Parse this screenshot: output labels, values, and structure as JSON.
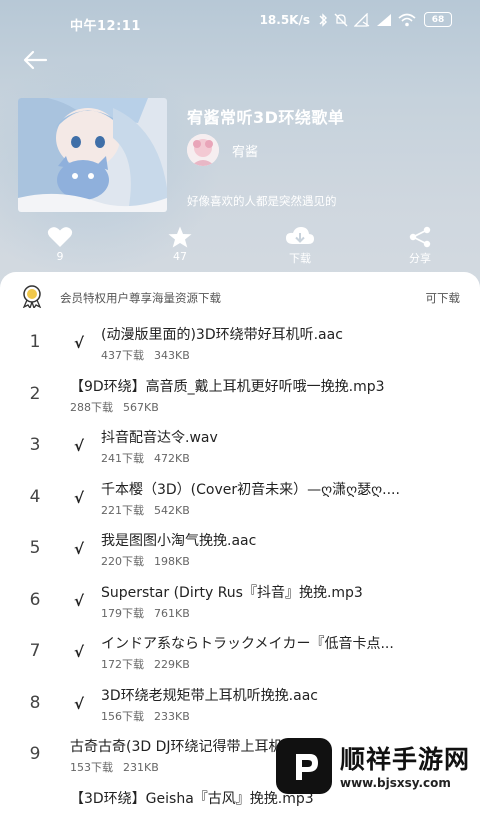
{
  "status_bar": {
    "time": "中午12:11",
    "network_speed": "18.5K/s",
    "battery": "68"
  },
  "header": {
    "title": "宥酱常听3D环绕歌单",
    "author": "宥酱",
    "description": "好像喜欢的人都是突然遇见的"
  },
  "actions": [
    {
      "icon": "heart-icon",
      "label": "9"
    },
    {
      "icon": "star-icon",
      "label": "47"
    },
    {
      "icon": "download-icon",
      "label": "下载"
    },
    {
      "icon": "share-icon",
      "label": "分享"
    }
  ],
  "vip_bar": {
    "text": "会员特权用户尊享海量资源下载",
    "link": "可下载"
  },
  "songs": [
    {
      "index": "1",
      "check": "√",
      "name": "(动漫版里面的)3D环绕带好耳机听.aac",
      "downloads": "437下载",
      "size": "343KB"
    },
    {
      "index": "2",
      "check": "",
      "name": "【9D环绕】高音质_戴上耳机更好听哦一挽挽.mp3",
      "downloads": "288下载",
      "size": "567KB"
    },
    {
      "index": "3",
      "check": "√",
      "name": "抖音配音达令.wav",
      "downloads": "241下载",
      "size": "472KB"
    },
    {
      "index": "4",
      "check": "√",
      "name": "千本樱（3D）(Cover初音未来）—ღ潇ღ瑟ღ....",
      "downloads": "221下载",
      "size": "542KB"
    },
    {
      "index": "5",
      "check": "√",
      "name": "我是图图小淘气挽挽.aac",
      "downloads": "220下载",
      "size": "198KB"
    },
    {
      "index": "6",
      "check": "√",
      "name": "Superstar (Dirty Rus『抖音』挽挽.mp3",
      "downloads": "179下载",
      "size": "761KB"
    },
    {
      "index": "7",
      "check": "√",
      "name": "インドア系ならトラックメイカー『低音卡点...",
      "downloads": "172下载",
      "size": "229KB"
    },
    {
      "index": "8",
      "check": "√",
      "name": "3D环绕老规矩带上耳机听挽挽.aac",
      "downloads": "156下载",
      "size": "233KB"
    },
    {
      "index": "9",
      "check": "",
      "name": "古奇古奇(3D DJ环绕记得带上耳机听)",
      "downloads": "153下载",
      "size": "231KB"
    },
    {
      "index": "",
      "check": "",
      "name": "【3D环绕】Geisha『古风』挽挽.mp3",
      "downloads": "",
      "size": ""
    }
  ],
  "watermark": {
    "title": "顺祥手游网",
    "url": "www.bjsxsy.com"
  }
}
